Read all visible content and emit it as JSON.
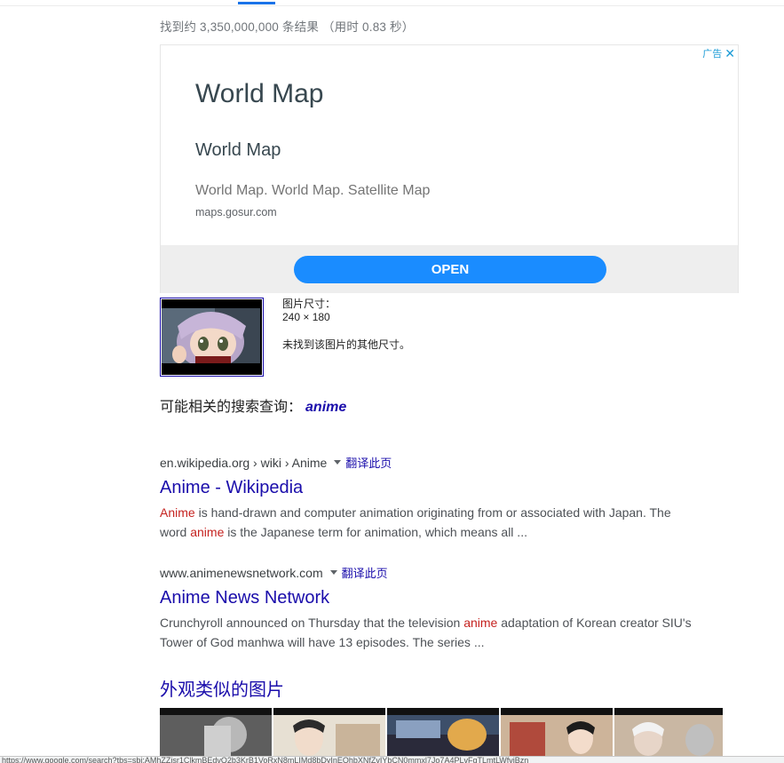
{
  "stats_text": "找到约 3,350,000,000 条结果 （用时 0.83 秒）",
  "ad": {
    "badge": "广告",
    "close_glyph": "✕",
    "headline": "World Map",
    "subheadline": "World Map",
    "description": "World Map. World Map. Satellite Map",
    "domain": "maps.gosur.com",
    "button": "OPEN"
  },
  "image_info": {
    "size_label": "图片尺寸：",
    "size_value": "240 × 180",
    "no_other": "未找到该图片的其他尺寸。"
  },
  "related": {
    "label": "可能相关的搜索查询：",
    "query": "anime"
  },
  "results": [
    {
      "cite": "en.wikipedia.org › wiki › Anime",
      "translate": "翻译此页",
      "title": "Anime - Wikipedia",
      "snippet": [
        {
          "t": "Anime",
          "em": true
        },
        {
          "t": " is hand-drawn and computer animation originating from or associated with Japan. The word ",
          "em": false
        },
        {
          "t": "anime",
          "em": true
        },
        {
          "t": " is the Japanese term for animation, which means all ...",
          "em": false
        }
      ]
    },
    {
      "cite": "www.animenewsnetwork.com",
      "translate": "翻译此页",
      "title": "Anime News Network",
      "snippet": [
        {
          "t": "Crunchyroll announced on Thursday that the television ",
          "em": false
        },
        {
          "t": "anime",
          "em": true
        },
        {
          "t": " adaptation of Korean creator SIU's Tower of God manhwa will have 13 episodes. The series ...",
          "em": false
        }
      ]
    }
  ],
  "similar_heading": "外观类似的图片",
  "status_url": "https://www.google.com/search?tbs=sbi:AMhZZisr1ClkmBEdvQ2b3KrB1VoRxN8mLIMd8bDyInEOhbXNfZvIYbCN0mmxl7Jo7A4PLvFqTLmtLWfvjBzn",
  "colors": {
    "link": "#1a0dab",
    "emphasis": "#c5221f",
    "ad_button": "#1a8cff",
    "ad_badge": "#1a9bd6"
  }
}
